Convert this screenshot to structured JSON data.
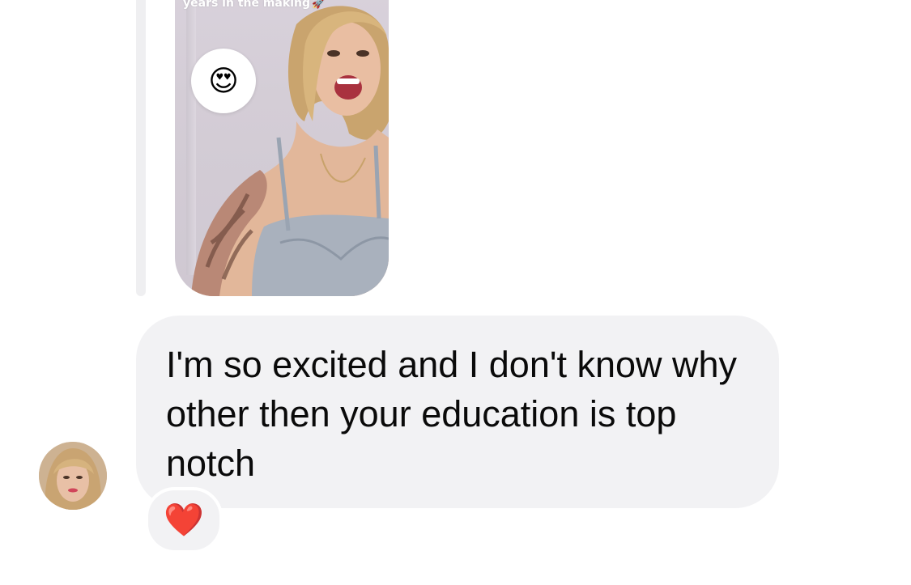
{
  "story_reply": {
    "caption": "years in the making",
    "caption_icon": "rocket-icon",
    "reaction_emoji": "😍"
  },
  "message": {
    "text": "I'm so excited and I don't know why other then your education is top notch",
    "reaction": "❤️"
  },
  "colors": {
    "bubble_bg": "#f2f2f4",
    "reply_bar": "#efeff1",
    "text": "#0a0a0a",
    "heart": "#e0202b"
  }
}
